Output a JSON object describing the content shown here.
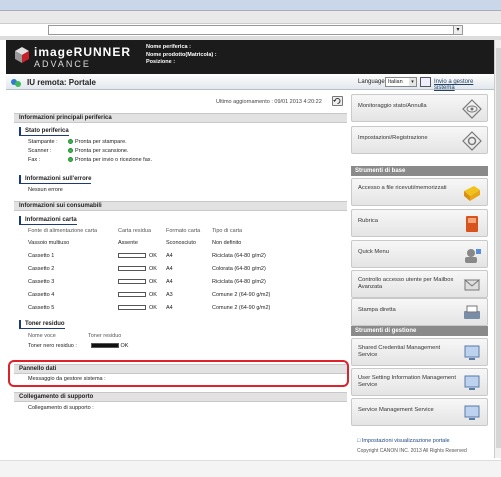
{
  "header": {
    "logo_main": "imageRUNNER",
    "logo_sub": "ADVANCE",
    "device_name_label": "Nome periferica :",
    "product_name_label": "Nome prodotto(Matricola) :",
    "location_label": "Posizione :"
  },
  "portal": {
    "title": "IU remota: Portale",
    "language_label": "Language:",
    "language_value": "Italian",
    "mail_link": "Invio a gestore sistema"
  },
  "main": {
    "last_update": "Ultimo aggiornamento : 09/01 2013 4:20:22",
    "device_info": {
      "title": "Informazioni principali periferica",
      "status_title": "Stato periferica",
      "status_rows": [
        {
          "label": "Stampante :",
          "value": "Pronta per stampare."
        },
        {
          "label": "Scanner :",
          "value": "Pronta per scansione."
        },
        {
          "label": "Fax :",
          "value": "Pronta per invio o ricezione fax."
        }
      ],
      "error_title": "Informazioni sull'errore",
      "error_value": "Nessun errore"
    },
    "consumables": {
      "title": "Informazioni sui consumabili",
      "paper_title": "Informazioni carta",
      "paper_headers": [
        "Fonte di alimentazione carta",
        "Carta residua",
        "Formato carta",
        "Tipo di carta"
      ],
      "paper_rows": [
        {
          "source": "Vassoio multiuso",
          "remaining": "Assente",
          "gauge": false,
          "format": "Sconosciuto",
          "type": "Non definito"
        },
        {
          "source": "Cassetto 1",
          "remaining": "OK",
          "gauge": true,
          "format": "A4",
          "type": "Riciclata (64-80 g/m2)"
        },
        {
          "source": "Cassetto 2",
          "remaining": "OK",
          "gauge": true,
          "format": "A4",
          "type": "Colorata (64-80 g/m2)"
        },
        {
          "source": "Cassetto 3",
          "remaining": "OK",
          "gauge": true,
          "format": "A4",
          "type": "Riciclata (64-80 g/m2)"
        },
        {
          "source": "Cassetto 4",
          "remaining": "OK",
          "gauge": true,
          "format": "A3",
          "type": "Comune 2 (64-90 g/m2)"
        },
        {
          "source": "Cassetto 5",
          "remaining": "OK",
          "gauge": true,
          "format": "A4",
          "type": "Comune 2 (64-90 g/m2)"
        }
      ],
      "toner_title": "Toner residuo",
      "toner_headers": [
        "Nome voce",
        "Toner residuo"
      ],
      "toner_row": {
        "label": "Toner nero residuo :",
        "value": "OK"
      }
    },
    "data_panel": {
      "title": "Pannello dati",
      "message_label": "Messaggio da gestore sistema :"
    },
    "support": {
      "title": "Collegamento di supporto",
      "link_label": "Collegamento di supporto :"
    }
  },
  "sidebar": {
    "top_buttons": [
      {
        "label": "Monitoraggio stato/Annulla",
        "icon": "monitor-eye-icon"
      },
      {
        "label": "Impostazioni/Registrazione",
        "icon": "settings-gear-icon"
      }
    ],
    "basic_tools_title": "Strumenti di base",
    "basic_tools": [
      {
        "label": "Accesso a file ricevuti/memorizzati",
        "icon": "folder-icon"
      },
      {
        "label": "Rubrica",
        "icon": "address-book-icon"
      },
      {
        "label": "Quick Menu",
        "icon": "quick-menu-icon"
      },
      {
        "label": "Controllo accesso utente per Mailbox Avanzata",
        "icon": "user-access-icon"
      },
      {
        "label": "Stampa diretta",
        "icon": "direct-print-icon"
      }
    ],
    "mgmt_tools_title": "Strumenti di gestione",
    "mgmt_tools": [
      {
        "label": "Shared Credential Management Service",
        "icon": "monitor-icon"
      },
      {
        "label": "User Setting Information Management Service",
        "icon": "monitor-icon"
      },
      {
        "label": "Service Management Service",
        "icon": "monitor-icon"
      }
    ],
    "portal_settings_link": "Impostazioni visualizzazione portale",
    "copyright": "Copyright CANON INC. 2013 All Rights Reserved"
  },
  "colors": {
    "highlight": "#e0202a",
    "status_green": "#37b84a",
    "section_bar": "#8a8a8a",
    "header_bg": "#1b1b1b"
  }
}
